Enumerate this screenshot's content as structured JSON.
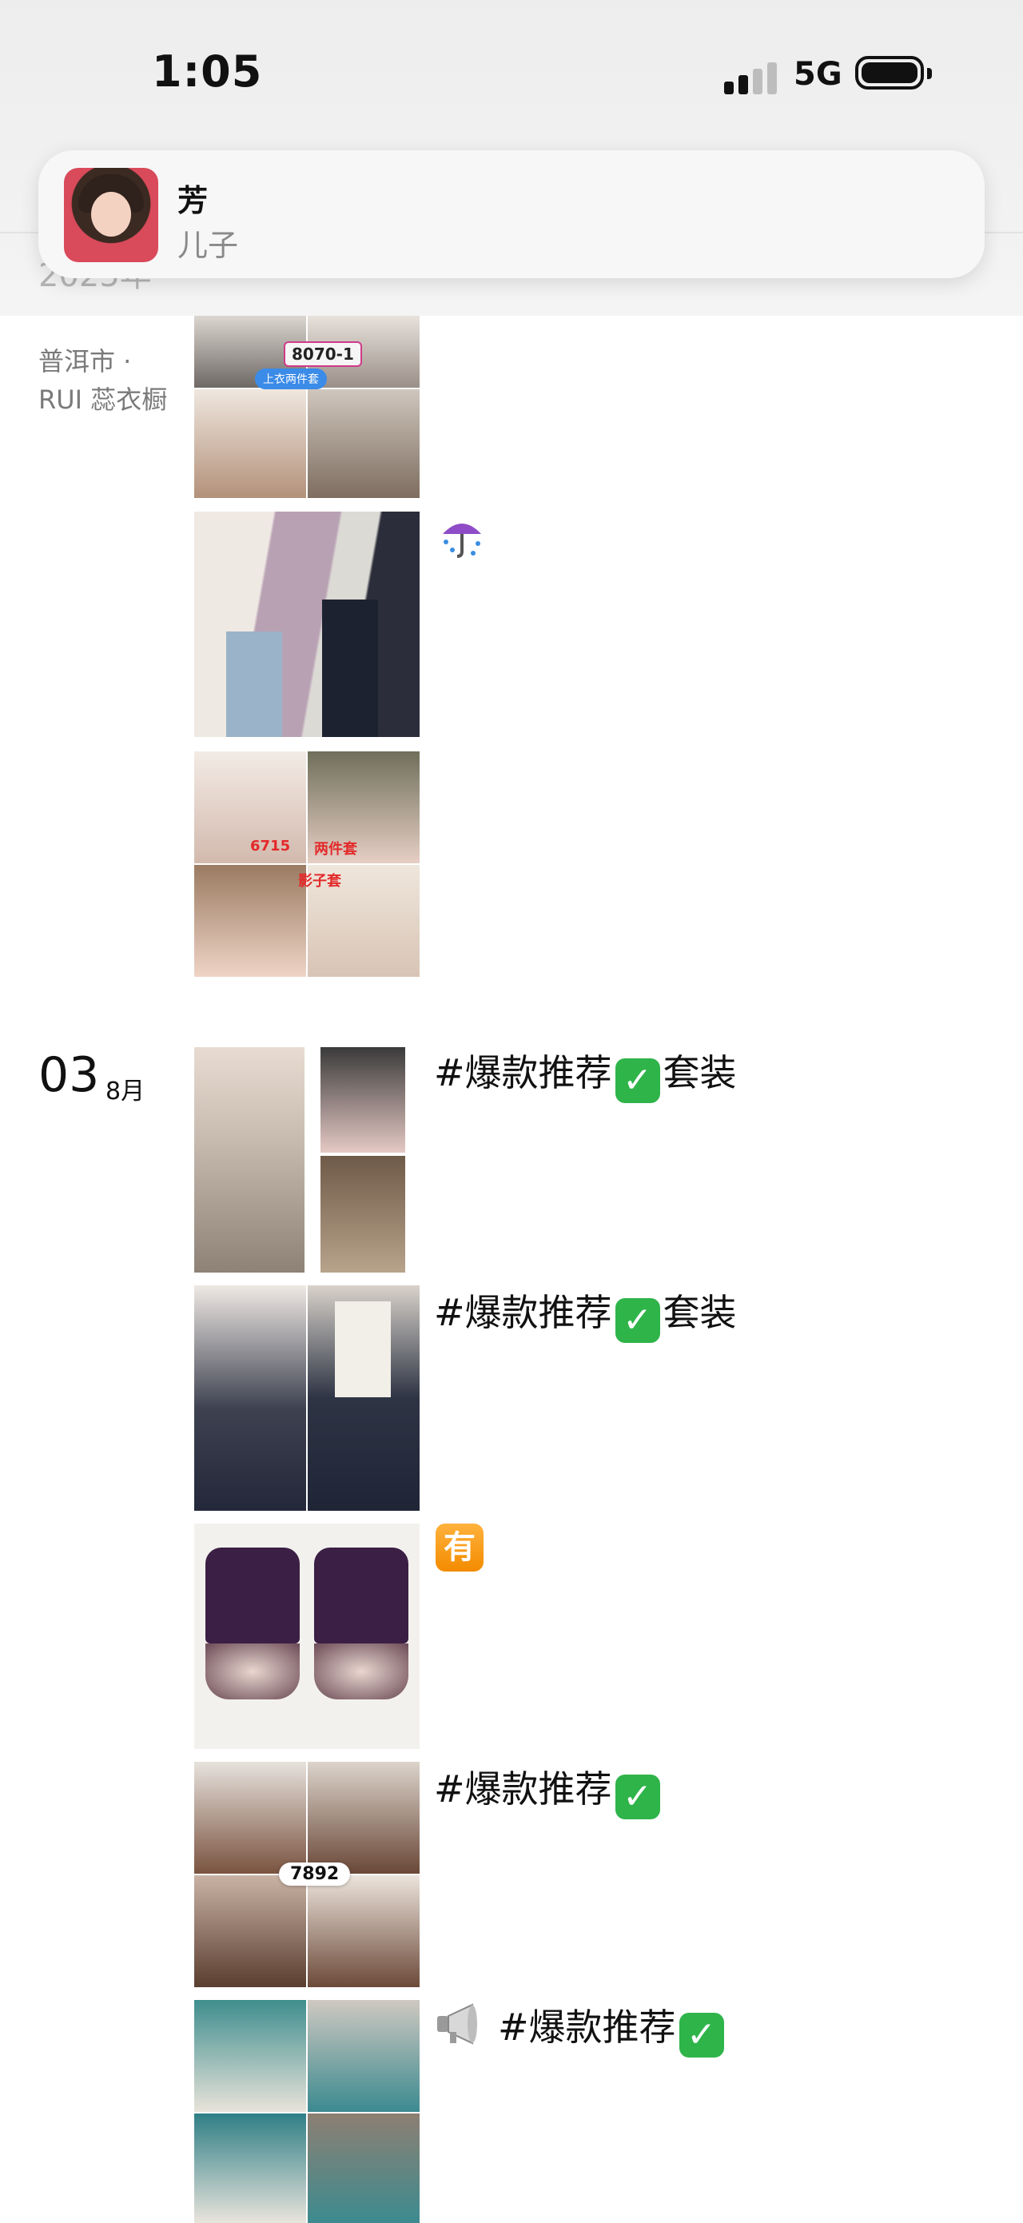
{
  "status_bar": {
    "time": "1:05",
    "network": "5G"
  },
  "notification": {
    "title": "芳",
    "subtitle": "儿子"
  },
  "sections": [
    {
      "year_partial": "2025年",
      "location_line1": "普洱市 ·",
      "location_line2": "RUI 蕊衣橱",
      "posts": [
        {
          "caption": "",
          "overlay_text": [
            "8070-1",
            "上衣两件套"
          ]
        },
        {
          "caption": "",
          "icon": "umbrella-with-rain-icon"
        },
        {
          "caption": "",
          "overlay_text": [
            "6715",
            "两件套",
            "影子套"
          ]
        }
      ]
    },
    {
      "day": "03",
      "month": "8月",
      "posts": [
        {
          "caption": "#爆款推荐",
          "suffix": "套装"
        },
        {
          "caption": "#爆款推荐",
          "suffix": "套装"
        },
        {
          "caption": "有"
        },
        {
          "caption": "#爆款推荐",
          "badge": "7892"
        },
        {
          "caption": "#爆款推荐",
          "icon": "megaphone-icon"
        }
      ]
    }
  ],
  "colors": {
    "check_green": "#2fb44a",
    "you_orange": "#f38b00",
    "text_gray": "#7a7a7a"
  }
}
